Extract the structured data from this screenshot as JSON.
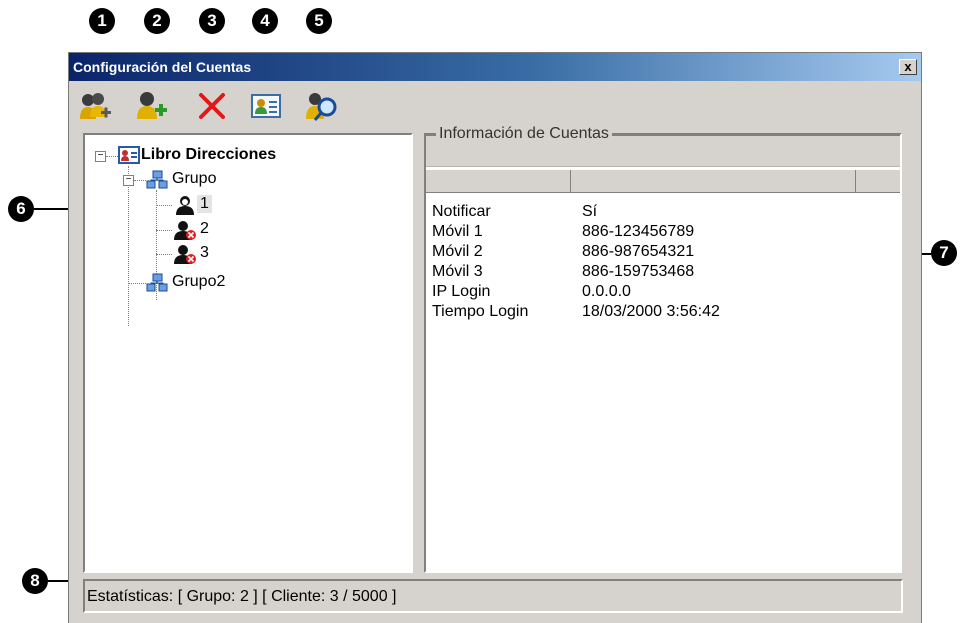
{
  "callouts": [
    "1",
    "2",
    "3",
    "4",
    "5",
    "6",
    "7",
    "8"
  ],
  "window": {
    "title": "Configuración del Cuentas",
    "close_label": "x"
  },
  "toolbar": {
    "buttons": [
      {
        "icon": "add-group-icon"
      },
      {
        "icon": "add-user-icon"
      },
      {
        "icon": "delete-icon"
      },
      {
        "icon": "address-card-icon"
      },
      {
        "icon": "search-user-icon"
      }
    ]
  },
  "tree": {
    "root": "Libro Direcciones",
    "groups": [
      {
        "label": "Grupo",
        "expanded": true,
        "children": [
          {
            "label": "1",
            "status": "online",
            "selected": true
          },
          {
            "label": "2",
            "status": "offline"
          },
          {
            "label": "3",
            "status": "offline"
          }
        ]
      },
      {
        "label": "Grupo2",
        "expanded": false
      }
    ],
    "expander_minus": "−"
  },
  "info": {
    "title": "Información de Cuentas",
    "rows": [
      {
        "key": "Notificar",
        "value": "Sí"
      },
      {
        "key": "Móvil 1",
        "value": "886-123456789"
      },
      {
        "key": "Móvil 2",
        "value": "886-987654321"
      },
      {
        "key": "Móvil 3",
        "value": "886-159753468"
      },
      {
        "key": "IP Login",
        "value": "0.0.0.0"
      },
      {
        "key": "Tiempo Login",
        "value": "18/03/2000 3:56:42"
      }
    ]
  },
  "status": {
    "text": "Estatísticas:  [ Grupo: 2 ]  [ Cliente: 3 / 5000 ]"
  },
  "colors": {
    "title_start": "#0a246a",
    "title_end": "#a6caf0",
    "delete_red": "#e01818",
    "window_bg": "#d6d3ce"
  }
}
